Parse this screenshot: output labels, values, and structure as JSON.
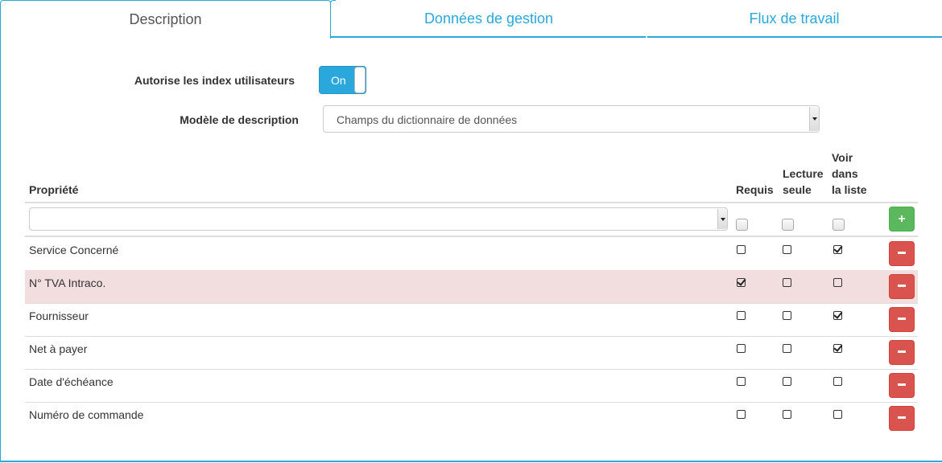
{
  "tabs": [
    {
      "label": "Description",
      "active": true
    },
    {
      "label": "Données de gestion",
      "active": false
    },
    {
      "label": "Flux de travail",
      "active": false
    }
  ],
  "form": {
    "user_index_label": "Autorise les index utilisateurs",
    "user_index_toggle": {
      "label": "On",
      "state": "on"
    },
    "description_model_label": "Modèle de description",
    "description_model_value": "Champs du dictionnaire de données"
  },
  "table": {
    "headers": {
      "property": "Propriété",
      "required": "Requis",
      "readonly_line1": "Lecture",
      "readonly_line2": "seule",
      "visible_line1": "Voir",
      "visible_line2": "dans",
      "visible_line3": "la liste"
    },
    "new_row": {
      "property_value": "",
      "add_label": "+",
      "required": false,
      "readonly": false,
      "visible": false
    },
    "rows": [
      {
        "name": "Service Concerné",
        "required": false,
        "readonly": false,
        "visible": true,
        "highlighted": false
      },
      {
        "name": "N° TVA Intraco.",
        "required": true,
        "readonly": false,
        "visible": false,
        "highlighted": true
      },
      {
        "name": "Fournisseur",
        "required": false,
        "readonly": false,
        "visible": true,
        "highlighted": false
      },
      {
        "name": "Net à payer",
        "required": false,
        "readonly": false,
        "visible": true,
        "highlighted": false
      },
      {
        "name": "Date d'échéance",
        "required": false,
        "readonly": false,
        "visible": false,
        "highlighted": false
      },
      {
        "name": "Numéro de commande",
        "required": false,
        "readonly": false,
        "visible": false,
        "highlighted": false
      }
    ]
  },
  "colors": {
    "accent": "#2aa8dc",
    "add_button": "#5cb85c",
    "remove_button": "#d9534f",
    "highlight_row": "#f2dede"
  }
}
